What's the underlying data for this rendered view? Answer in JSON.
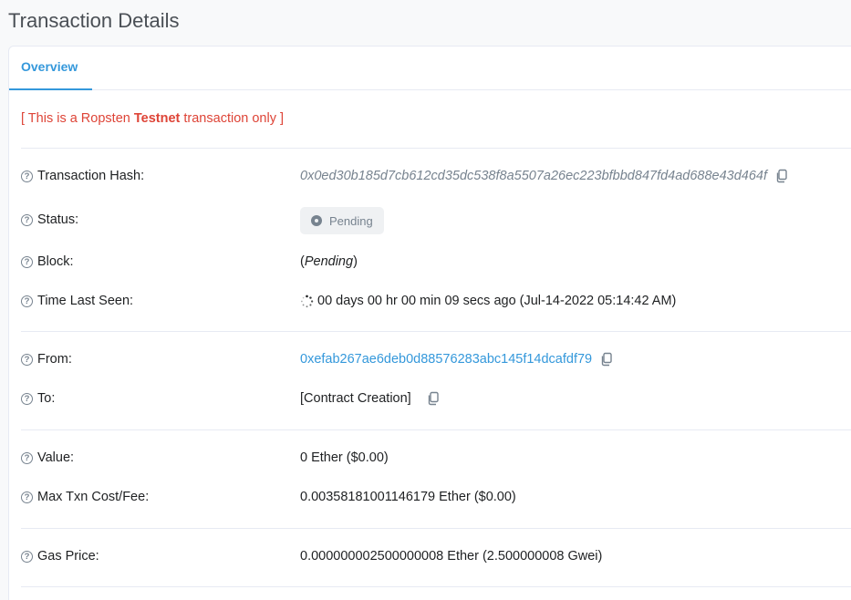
{
  "page": {
    "title": "Transaction Details"
  },
  "tabs": [
    {
      "label": "Overview"
    }
  ],
  "notice": {
    "prefix": "[ This is a Ropsten ",
    "bold": "Testnet",
    "suffix": " transaction only ]"
  },
  "rows": {
    "tx_hash": {
      "label": "Transaction Hash:",
      "value": "0x0ed30b185d7cb612cd35dc538f8a5507a26ec223bfbbd847fd4ad688e43d464f"
    },
    "status": {
      "label": "Status:",
      "value": "Pending"
    },
    "block": {
      "label": "Block:",
      "open": "(",
      "value": "Pending",
      "close": ")"
    },
    "time": {
      "label": "Time Last Seen:",
      "value": "00 days 00 hr 00 min 09 secs ago (Jul-14-2022 05:14:42 AM)"
    },
    "from": {
      "label": "From:",
      "value": "0xefab267ae6deb0d88576283abc145f14dcafdf79"
    },
    "to": {
      "label": "To:",
      "value": "[Contract Creation]"
    },
    "value": {
      "label": "Value:",
      "value": "0 Ether ($0.00)"
    },
    "max_fee": {
      "label": "Max Txn Cost/Fee:",
      "value": "0.00358181001146179 Ether ($0.00)"
    },
    "gas_price": {
      "label": "Gas Price:",
      "value": "0.000000002500000008 Ether (2.500000008 Gwei)"
    }
  },
  "icons": {
    "help": "question-circle-icon",
    "copy": "copy-icon",
    "status": "dot-circle-icon",
    "spinner": "spinner-icon"
  },
  "colors": {
    "accent": "#3498db",
    "notice": "#de4437",
    "muted": "#77838f"
  }
}
